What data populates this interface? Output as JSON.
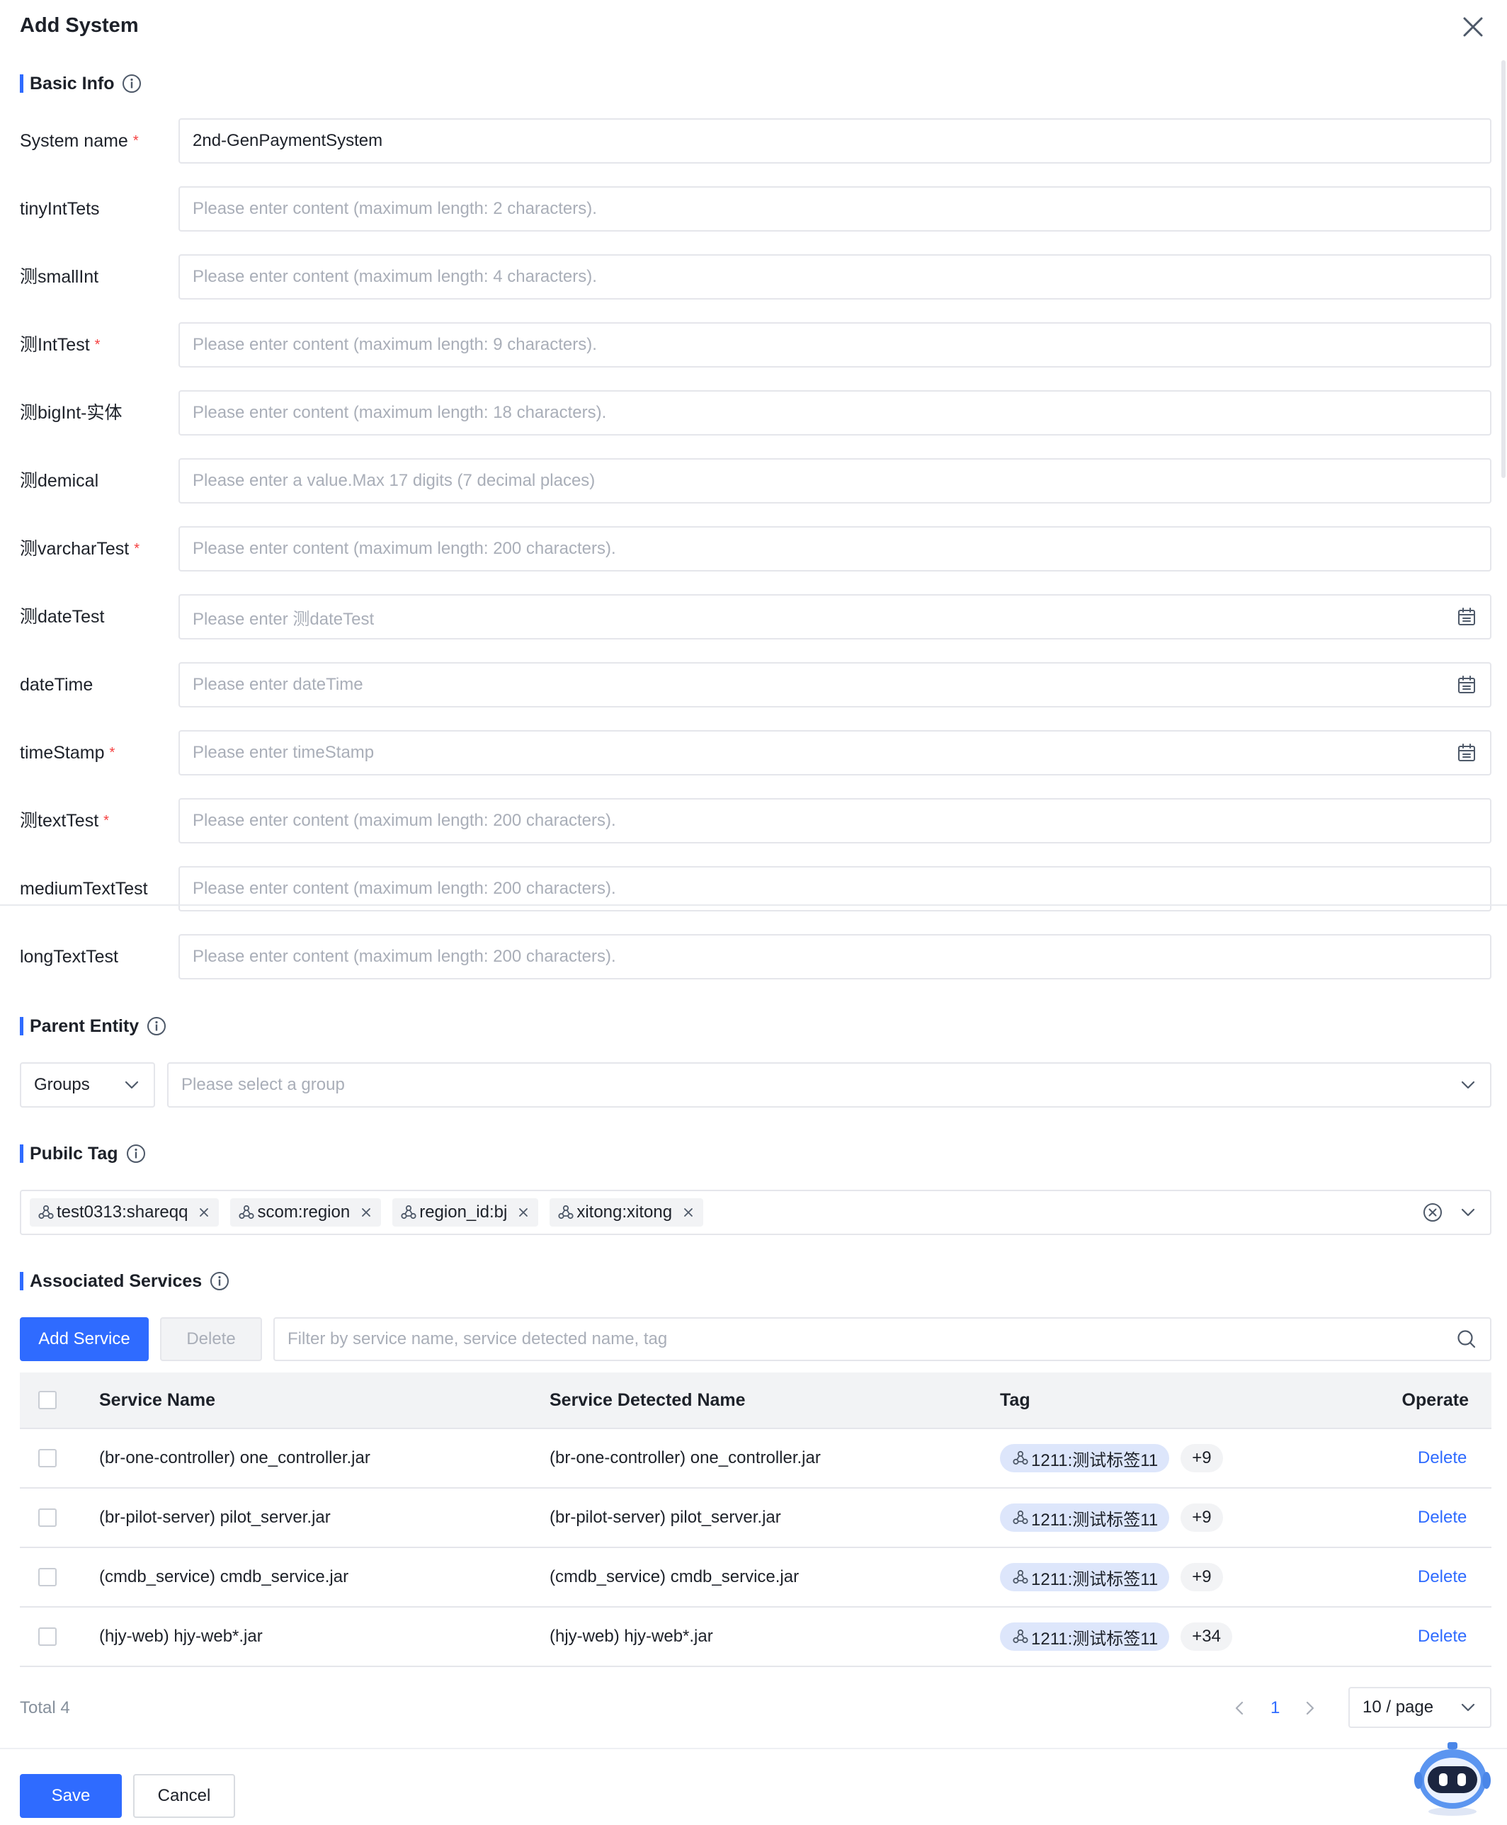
{
  "dialog": {
    "title": "Add System"
  },
  "sections": {
    "basic_info": "Basic Info",
    "parent_entity": "Parent Entity",
    "public_tag": "Pubilc Tag",
    "associated_services": "Associated Services"
  },
  "fields": [
    {
      "label": "System name",
      "required": true,
      "value": "2nd-GenPaymentSystem",
      "placeholder": "",
      "type": "text"
    },
    {
      "label": "tinyIntTets",
      "required": false,
      "value": "",
      "placeholder": "Please enter content (maximum length: 2 characters).",
      "type": "text"
    },
    {
      "label": "测smallInt",
      "required": false,
      "value": "",
      "placeholder": "Please enter content (maximum length: 4 characters).",
      "type": "text"
    },
    {
      "label": "测IntTest",
      "required": true,
      "value": "",
      "placeholder": "Please enter content (maximum length: 9 characters).",
      "type": "text"
    },
    {
      "label": "测bigInt-实体",
      "required": false,
      "value": "",
      "placeholder": "Please enter content (maximum length: 18 characters).",
      "type": "text"
    },
    {
      "label": "测demical",
      "required": false,
      "value": "",
      "placeholder": "Please enter a value.Max 17 digits (7 decimal places)",
      "type": "text"
    },
    {
      "label": "测varcharTest",
      "required": true,
      "value": "",
      "placeholder": "Please enter content (maximum length: 200 characters).",
      "type": "text"
    },
    {
      "label": "测dateTest",
      "required": false,
      "value": "",
      "placeholder": "Please enter 测dateTest",
      "type": "date"
    },
    {
      "label": "dateTime",
      "required": false,
      "value": "",
      "placeholder": "Please enter dateTime",
      "type": "date"
    },
    {
      "label": "timeStamp",
      "required": true,
      "value": "",
      "placeholder": "Please enter timeStamp",
      "type": "date"
    },
    {
      "label": "测textTest",
      "required": true,
      "value": "",
      "placeholder": "Please enter content (maximum length: 200 characters).",
      "type": "text"
    },
    {
      "label": "mediumTextTest",
      "required": false,
      "value": "",
      "placeholder": "Please enter content (maximum length: 200 characters).",
      "type": "text"
    },
    {
      "label": "longTextTest",
      "required": false,
      "value": "",
      "placeholder": "Please enter content (maximum length: 200 characters).",
      "type": "text"
    }
  ],
  "parent_entity": {
    "type_value": "Groups",
    "group_placeholder": "Please select a group"
  },
  "public_tags": [
    "test0313:shareqq",
    "scom:region",
    "region_id:bj",
    "xitong:xitong"
  ],
  "services": {
    "add_button": "Add Service",
    "delete_button": "Delete",
    "filter_placeholder": "Filter by service name, service detected name, tag",
    "columns": [
      "Service Name",
      "Service Detected Name",
      "Tag",
      "Operate"
    ],
    "rows": [
      {
        "name": "(br-one-controller) one_controller.jar",
        "detected": "(br-one-controller) one_controller.jar",
        "tag": "1211:测试标签11",
        "more": "+9",
        "op": "Delete"
      },
      {
        "name": "(br-pilot-server) pilot_server.jar",
        "detected": "(br-pilot-server) pilot_server.jar",
        "tag": "1211:测试标签11",
        "more": "+9",
        "op": "Delete"
      },
      {
        "name": "(cmdb_service) cmdb_service.jar",
        "detected": "(cmdb_service) cmdb_service.jar",
        "tag": "1211:测试标签11",
        "more": "+9",
        "op": "Delete"
      },
      {
        "name": "(hjy-web) hjy-web*.jar",
        "detected": "(hjy-web) hjy-web*.jar",
        "tag": "1211:测试标签11",
        "more": "+34",
        "op": "Delete"
      }
    ]
  },
  "pagination": {
    "total": "Total 4",
    "current_page": "1",
    "page_size": "10 / page"
  },
  "footer": {
    "save": "Save",
    "cancel": "Cancel"
  },
  "colors": {
    "primary": "#2f6bff",
    "required": "#f53f3f",
    "border": "#e5e6eb"
  },
  "icons": [
    "close-icon",
    "info-icon",
    "calendar-icon",
    "chevron-down-icon",
    "tag-icon",
    "clear-icon",
    "search-icon",
    "assistant-robot-icon"
  ]
}
